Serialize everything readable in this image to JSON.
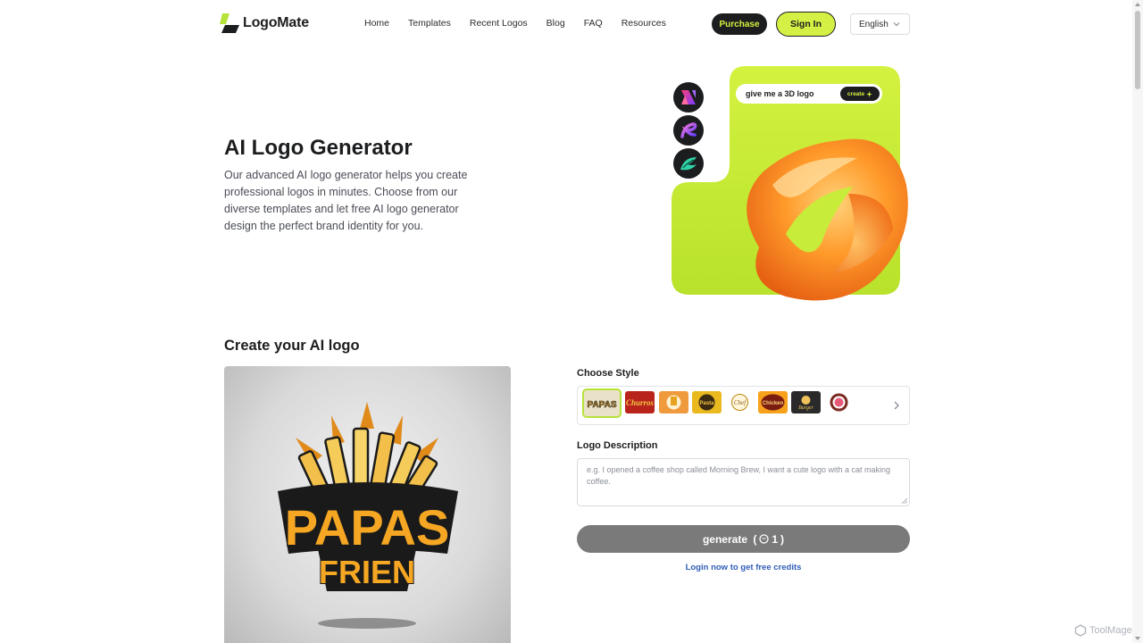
{
  "brand": {
    "name": "LogoMate"
  },
  "nav": {
    "items": [
      {
        "label": "Home"
      },
      {
        "label": "Templates"
      },
      {
        "label": "Recent Logos"
      },
      {
        "label": "Blog"
      },
      {
        "label": "FAQ"
      },
      {
        "label": "Resources"
      }
    ]
  },
  "header": {
    "purchase_label": "Purchase",
    "signin_label": "Sign In",
    "language": "English"
  },
  "hero": {
    "title": "AI Logo Generator",
    "description": "Our advanced AI logo generator helps you create professional logos in minutes. Choose from our diverse templates and let free AI logo generator design the perfect brand identity for you.",
    "prompt_text": "give me a 3D logo",
    "prompt_button": "create"
  },
  "create": {
    "title": "Create your AI logo",
    "preview_text_top": "PAPAS",
    "preview_text_bottom": "FRIEN",
    "choose_style_label": "Choose Style",
    "styles": [
      {
        "name": "Papas",
        "bg": "#e9e2c9",
        "fg": "#e7a21f"
      },
      {
        "name": "Churros",
        "bg": "#b8241c",
        "fg": "#f5c542"
      },
      {
        "name": "Fries",
        "bg": "#ef9a3c",
        "fg": "#fff1cf"
      },
      {
        "name": "Pasta",
        "bg": "#e9b91f",
        "fg": "#3a2a10"
      },
      {
        "name": "Chef",
        "bg": "#ffffff",
        "fg": "#b8860b"
      },
      {
        "name": "Chicken",
        "bg": "#f7a11c",
        "fg": "#7a1c10"
      },
      {
        "name": "Burger",
        "bg": "#2a2a2a",
        "fg": "#f0c15a"
      },
      {
        "name": "Donut",
        "bg": "#ffffff",
        "fg": "#7a2a20"
      }
    ],
    "description_label": "Logo Description",
    "description_placeholder": "e.g. I opened a coffee shop called Morning Brew, I want a cute logo with a cat making coffee.",
    "generate_label": "generate",
    "generate_cost": "1",
    "login_link": "Login now to get free credits"
  },
  "watermark": "ToolMage",
  "colors": {
    "accent": "#d4f044",
    "dark": "#1c1d1f",
    "link": "#2f5db8",
    "button_disabled": "#7a7a7a"
  }
}
